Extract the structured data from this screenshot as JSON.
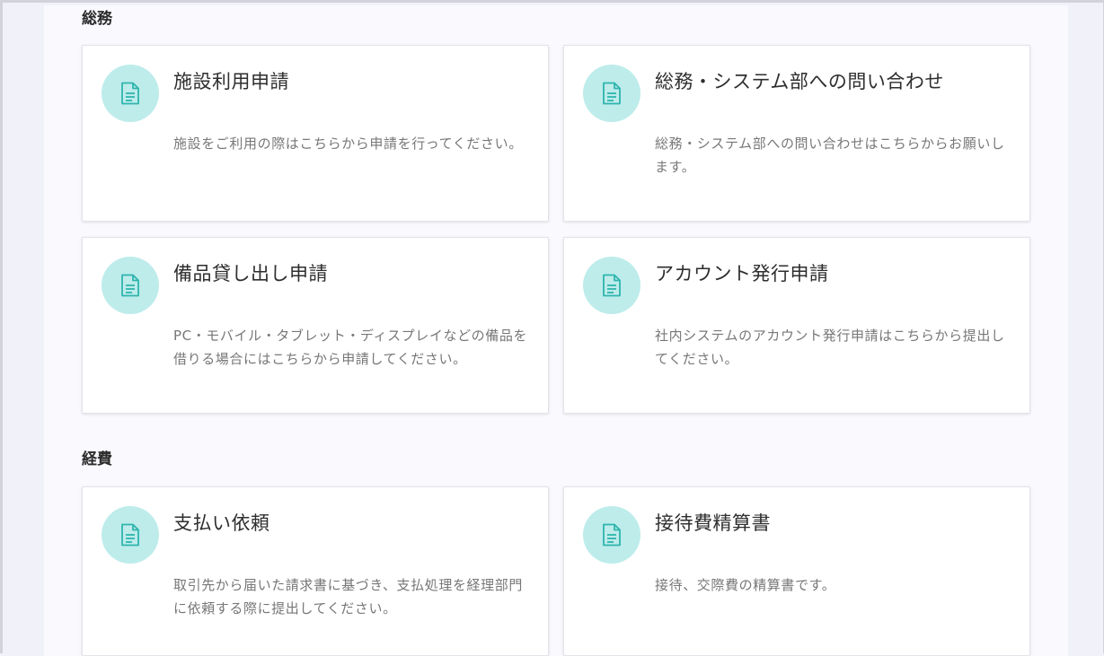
{
  "colors": {
    "icon_bg": "#bdeceb",
    "icon_stroke": "#2fb5ad",
    "page_bg": "#f1f1fa"
  },
  "sections": [
    {
      "title": "総務",
      "cards": [
        {
          "title": "施設利用申請",
          "desc": "施設をご利用の際はこちらから申請を行ってください。",
          "icon": "document-icon"
        },
        {
          "title": "総務・システム部への問い合わせ",
          "desc": "総務・システム部への問い合わせはこちらからお願いします。",
          "icon": "document-icon"
        },
        {
          "title": "備品貸し出し申請",
          "desc": "PC・モバイル・タブレット・ディスプレイなどの備品を借りる場合にはこちらから申請してください。",
          "icon": "document-icon"
        },
        {
          "title": "アカウント発行申請",
          "desc": "社内システムのアカウント発行申請はこちらから提出してください。",
          "icon": "document-icon"
        }
      ]
    },
    {
      "title": "経費",
      "cards": [
        {
          "title": "支払い依頼",
          "desc": "取引先から届いた請求書に基づき、支払処理を経理部門に依頼する際に提出してください。",
          "icon": "document-icon"
        },
        {
          "title": "接待費精算書",
          "desc": "接待、交際費の精算書です。",
          "icon": "document-icon"
        }
      ]
    }
  ]
}
